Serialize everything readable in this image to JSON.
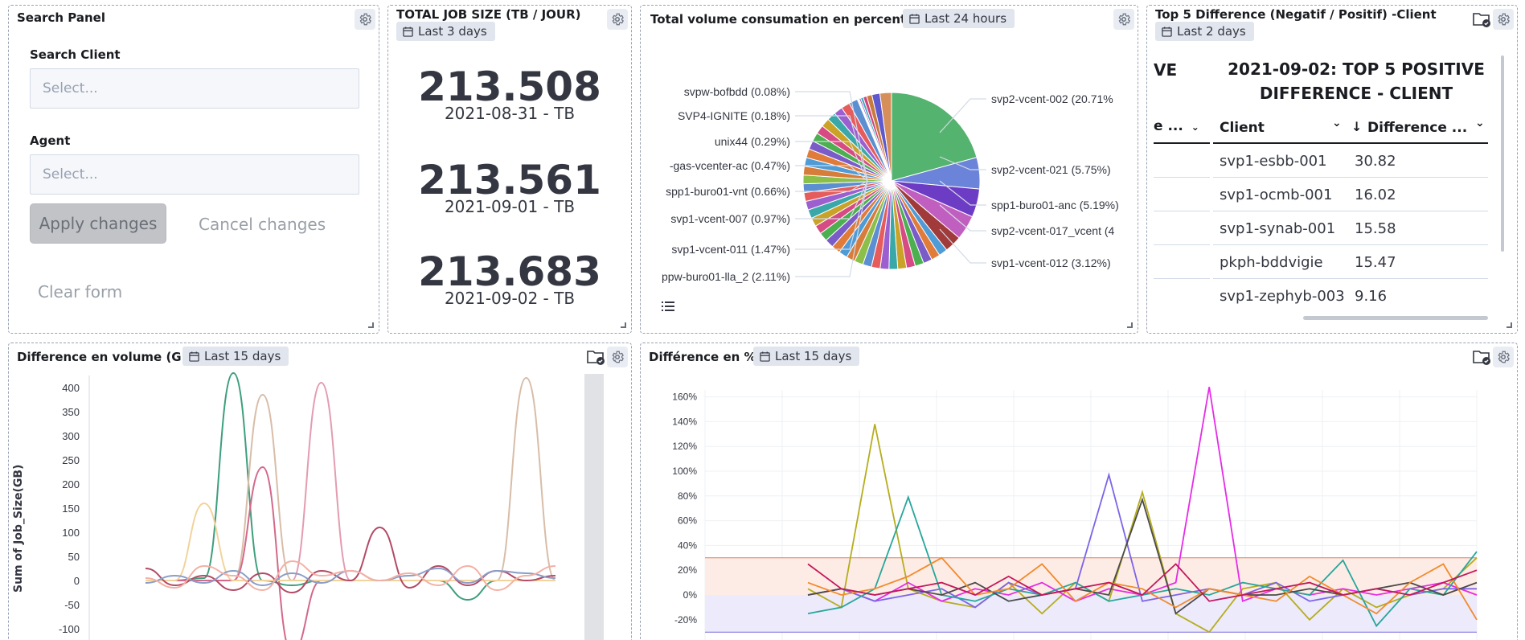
{
  "search_panel": {
    "title": "Search Panel",
    "client_label": "Search Client",
    "client_placeholder": "Select...",
    "agent_label": "Agent",
    "agent_placeholder": "Select...",
    "apply_label": "Apply changes",
    "cancel_label": "Cancel changes",
    "clear_label": "Clear form"
  },
  "job_size": {
    "title": "TOTAL JOB SIZE (TB / JOUR)",
    "badge": "Last 3 days",
    "metrics": [
      {
        "value": "213.508",
        "label": "2021-08-31 - TB"
      },
      {
        "value": "213.561",
        "label": "2021-09-01 - TB"
      },
      {
        "value": "213.683",
        "label": "2021-09-02 - TB"
      }
    ]
  },
  "volume_pie": {
    "title": "Total volume consumation en percentage",
    "badge": "Last 24 hours",
    "labels_left": [
      "svpw-bofbdd (0.08%)",
      "SVP4-IGNITE (0.18%)",
      "unix44 (0.29%)",
      "-gas-vcenter-ac (0.47%)",
      "spp1-buro01-vnt (0.66%)",
      "svp1-vcent-007 (0.97%)",
      "svp1-vcent-011 (1.47%)",
      "ppw-buro01-lla_2 (2.11%)"
    ],
    "labels_right": [
      "svp2-vcent-002 (20.71%",
      "svp2-vcent-021 (5.75%)",
      "spp1-buro01-anc (5.19%)",
      "svp2-vcent-017_vcent (4",
      "svp1-vcent-012 (3.12%)"
    ]
  },
  "top5": {
    "title": "Top 5 Difference (Negatif / Positif) -Client",
    "badge": "Last 2 days",
    "left_partial_heading": "VE",
    "left_partial_col": "e ...",
    "heading": "2021-09-02: TOP 5 POSITIVE DIFFERENCE - CLIENT",
    "col_client": "Client",
    "col_diff": "Difference ...",
    "rows": [
      {
        "client": "svp1-esbb-001",
        "diff": "30.82"
      },
      {
        "client": "svp1-ocmb-001",
        "diff": "16.02"
      },
      {
        "client": "svp1-synab-001",
        "diff": "15.58"
      },
      {
        "client": "pkph-bddvigie",
        "diff": "15.47"
      },
      {
        "client": "svp1-zephyb-003",
        "diff": "9.16"
      }
    ]
  },
  "diff_volume": {
    "title": "Difference en volume (GB)",
    "badge": "Last 15 days",
    "ylabel": "Sum of Job_Size(GB)",
    "yticks": [
      "400",
      "350",
      "300",
      "250",
      "200",
      "150",
      "100",
      "50",
      "0",
      "-50",
      "-100"
    ]
  },
  "diff_pct": {
    "title": "Différence en %",
    "badge": "Last 15 days",
    "yticks": [
      "160%",
      "140%",
      "120%",
      "100%",
      "80%",
      "60%",
      "40%",
      "20%",
      "0%",
      "-20%"
    ]
  },
  "chart_data": [
    {
      "type": "pie",
      "title": "Total volume consumation en percentage",
      "categories": [
        "svp2-vcent-002",
        "svp2-vcent-021",
        "spp1-buro01-anc",
        "svp2-vcent-017_vcent",
        "svp1-vcent-012",
        "ppw-buro01-lla_2",
        "svp1-vcent-011",
        "svp1-vcent-007",
        "spp1-buro01-vnt",
        "-gas-vcenter-ac",
        "unix44",
        "SVP4-IGNITE",
        "svpw-bofbdd"
      ],
      "values": [
        20.71,
        5.75,
        5.19,
        4.5,
        3.12,
        2.11,
        1.47,
        0.97,
        0.66,
        0.47,
        0.29,
        0.18,
        0.08
      ],
      "colors": [
        "#54b36e",
        "#6b83d9",
        "#6d3cc4",
        "#c15fc0",
        "#a13a3a",
        "#d68f5a",
        "#5e59cf",
        "#c97b3b",
        "#d2417c",
        "#3fa6b8",
        "#8d4fc4",
        "#d6a64a",
        "#4d8fd6"
      ]
    },
    {
      "type": "line",
      "title": "Difference en volume (GB)",
      "ylabel": "Sum of Job_Size(GB)",
      "ylim": [
        -100,
        400
      ],
      "x": [
        0,
        1,
        2,
        3,
        4,
        5,
        6,
        7,
        8,
        9,
        10,
        11,
        12,
        13,
        14
      ],
      "series": [
        {
          "color": "#3d9f7c",
          "values": [
            0,
            0,
            5,
            430,
            0,
            -10,
            0,
            0,
            0,
            0,
            0,
            -40,
            0,
            0,
            0
          ]
        },
        {
          "color": "#d8bda8",
          "values": [
            0,
            0,
            0,
            0,
            385,
            0,
            0,
            0,
            0,
            0,
            0,
            0,
            0,
            420,
            0
          ]
        },
        {
          "color": "#e39cb1",
          "values": [
            0,
            0,
            0,
            0,
            0,
            0,
            410,
            0,
            0,
            0,
            0,
            0,
            0,
            0,
            0
          ]
        },
        {
          "color": "#d3698a",
          "values": [
            0,
            0,
            0,
            0,
            235,
            -150,
            0,
            0,
            0,
            0,
            0,
            0,
            0,
            0,
            0
          ]
        },
        {
          "color": "#f2d39c",
          "values": [
            0,
            0,
            160,
            0,
            0,
            0,
            0,
            0,
            0,
            0,
            0,
            0,
            0,
            0,
            0
          ]
        },
        {
          "color": "#b34a66",
          "values": [
            25,
            -10,
            10,
            -20,
            15,
            -25,
            20,
            0,
            110,
            -15,
            30,
            -10,
            20,
            0,
            10
          ]
        },
        {
          "color": "#8a9ec8",
          "values": [
            -5,
            10,
            -5,
            20,
            -10,
            15,
            -5,
            20,
            0,
            10,
            25,
            -5,
            20,
            15,
            5
          ]
        },
        {
          "color": "#f4b0a4",
          "values": [
            5,
            -15,
            30,
            10,
            -20,
            40,
            10,
            20,
            0,
            15,
            -10,
            30,
            -20,
            10,
            30
          ]
        }
      ]
    },
    {
      "type": "line",
      "title": "Différence en %",
      "ylim": [
        -25,
        170
      ],
      "x": [
        0,
        1,
        2,
        3,
        4,
        5,
        6,
        7,
        8,
        9,
        10,
        11,
        12,
        13,
        14,
        15,
        16,
        17,
        18,
        19,
        20
      ],
      "series": [
        {
          "color": "#b5ad1c",
          "values": [
            5,
            -10,
            138,
            5,
            -5,
            -10,
            10,
            -15,
            10,
            -5,
            83,
            -15,
            -30,
            5,
            10,
            -20,
            5,
            -10,
            0,
            5,
            30
          ]
        },
        {
          "color": "#e52ce7",
          "values": [
            0,
            5,
            -5,
            10,
            -5,
            5,
            0,
            10,
            -5,
            5,
            0,
            10,
            168,
            -5,
            5,
            0,
            5,
            0,
            5,
            10,
            0
          ]
        },
        {
          "color": "#7c64e8",
          "values": [
            0,
            5,
            -5,
            0,
            5,
            -10,
            10,
            0,
            5,
            97,
            -5,
            0,
            5,
            0,
            10,
            -5,
            0,
            5,
            0,
            5,
            5
          ]
        },
        {
          "color": "#26a69a",
          "values": [
            -15,
            -10,
            5,
            79,
            0,
            -5,
            5,
            0,
            10,
            -5,
            0,
            5,
            0,
            10,
            5,
            0,
            28,
            -25,
            5,
            0,
            35
          ]
        },
        {
          "color": "#4b4b4b",
          "values": [
            0,
            5,
            0,
            5,
            0,
            10,
            -5,
            0,
            5,
            0,
            77,
            -15,
            5,
            0,
            0,
            5,
            0,
            5,
            10,
            0,
            10
          ]
        },
        {
          "color": "#f28a2c",
          "values": [
            10,
            0,
            5,
            15,
            30,
            0,
            5,
            25,
            -5,
            10,
            5,
            -10,
            5,
            0,
            -5,
            15,
            0,
            -15,
            10,
            25,
            -20
          ]
        },
        {
          "color": "#c2185b",
          "values": [
            25,
            5,
            0,
            5,
            10,
            0,
            15,
            0,
            5,
            10,
            0,
            25,
            -5,
            0,
            5,
            10,
            0,
            5,
            0,
            10,
            20
          ]
        }
      ]
    }
  ]
}
